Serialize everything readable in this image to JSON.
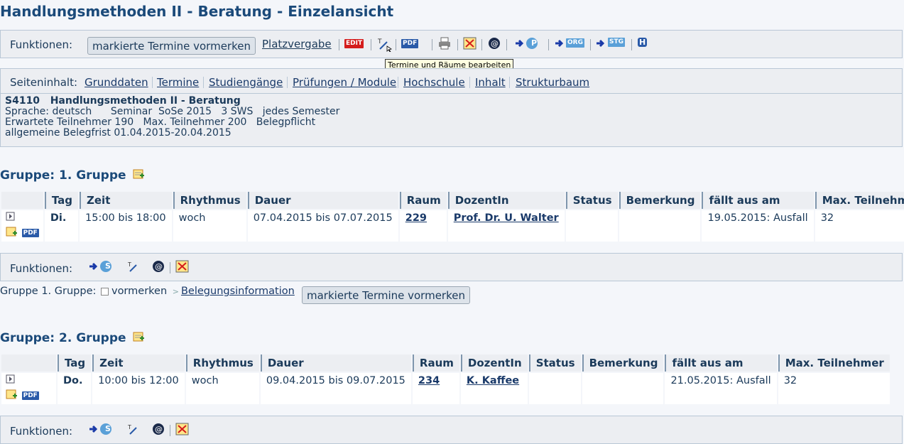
{
  "page": {
    "title": "Handlungsmethoden II - Beratung - Einzelansicht"
  },
  "toolbar": {
    "label": "Funktionen:",
    "vormerken_button": "markierte Termine vormerken",
    "platzvergabe_link": "Platzvergabe",
    "edit_badge": "EDIT",
    "pdf_badge": "PDF",
    "p_badge": "P",
    "org_badge": "ORG",
    "stg_badge": "STG",
    "h_badge": "H",
    "tooltip": "Termine und Räume bearbeiten"
  },
  "nav": {
    "label": "Seiteninhalt:",
    "links": [
      "Grunddaten",
      "Termine",
      "Studiengänge",
      "Prüfungen / Module",
      "Hochschule",
      "Inhalt",
      "Strukturbaum"
    ]
  },
  "info": {
    "code": "S4110",
    "name": "Handlungsmethoden II - Beratung",
    "line2": "Sprache: deutsch      Seminar  SoSe 2015   3 SWS   jedes Semester",
    "line3": "Erwartete Teilnehmer 190   Max. Teilnehmer 200   Belegpflicht",
    "line4": "allgemeine Belegfrist 01.04.2015-20.04.2015"
  },
  "table_headers": [
    "Tag",
    "Zeit",
    "Rhythmus",
    "Dauer",
    "Raum",
    "DozentIn",
    "Status",
    "Bemerkung",
    "fällt aus am",
    "Max. Teilnehmer"
  ],
  "groups": [
    {
      "title": "Gruppe: 1. Gruppe",
      "row": {
        "pdf": "PDF",
        "tag": "Di.",
        "zeit": "15:00 bis 18:00",
        "rhythmus": "woch",
        "dauer": "07.04.2015 bis 07.07.2015",
        "raum": "229",
        "dozent": "Prof. Dr. U. Walter",
        "status": "",
        "bemerkung": "",
        "faellt_aus": "19.05.2015: Ausfall",
        "max": "32"
      },
      "func_label": "Funktionen:",
      "s_badge": "S",
      "vormerk_line": {
        "prefix": "Gruppe 1. Gruppe:",
        "vormerken": "vormerken",
        "belegung_link": "Belegungsinformation",
        "button": "markierte Termine vormerken"
      }
    },
    {
      "title": "Gruppe: 2. Gruppe",
      "row": {
        "pdf": "PDF",
        "tag": "Do.",
        "zeit": "10:00 bis 12:00",
        "rhythmus": "woch",
        "dauer": "09.04.2015 bis 09.07.2015",
        "raum": "234",
        "dozent": "K. Kaffee",
        "status": "",
        "bemerkung": "",
        "faellt_aus": "21.05.2015: Ausfall",
        "max": "32"
      },
      "func_label": "Funktionen:",
      "s_badge": "S"
    }
  ],
  "colors": {
    "title": "#1b4a7a",
    "edit_badge": "#d41c1c",
    "pdf_badge": "#2a5aa8",
    "org_badge": "#5aa0d8",
    "accent_blue": "#1a3aa8"
  }
}
